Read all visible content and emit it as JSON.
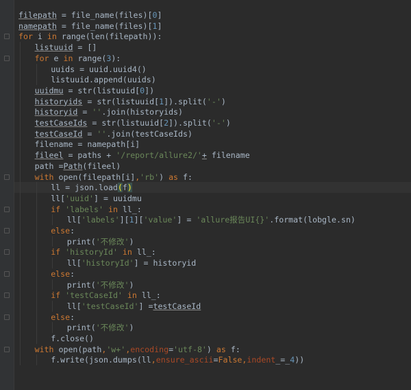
{
  "lines": [
    {
      "indent": 0,
      "tokens": [
        {
          "t": "filepath",
          "c": "u"
        },
        {
          "t": " = file_name(files)["
        },
        {
          "t": "0",
          "c": "num"
        },
        {
          "t": "]"
        }
      ]
    },
    {
      "indent": 0,
      "tokens": [
        {
          "t": "namepath",
          "c": "u"
        },
        {
          "t": " = file_name(files)["
        },
        {
          "t": "1",
          "c": "num"
        },
        {
          "t": "]"
        }
      ]
    },
    {
      "indent": 0,
      "tokens": [
        {
          "t": "for",
          "c": "kw"
        },
        {
          "t": " i "
        },
        {
          "t": "in",
          "c": "kw"
        },
        {
          "t": " range(len(filepath)):"
        }
      ]
    },
    {
      "indent": 1,
      "tokens": [
        {
          "t": "listuuid",
          "c": "u"
        },
        {
          "t": " = []"
        }
      ]
    },
    {
      "indent": 1,
      "tokens": [
        {
          "t": "for",
          "c": "kw"
        },
        {
          "t": " e "
        },
        {
          "t": "in",
          "c": "kw"
        },
        {
          "t": " range("
        },
        {
          "t": "3",
          "c": "num"
        },
        {
          "t": "):"
        }
      ]
    },
    {
      "indent": 2,
      "tokens": [
        {
          "t": "uuids = uuid.uuid4()"
        }
      ]
    },
    {
      "indent": 2,
      "tokens": [
        {
          "t": "listuuid.append(uuids)"
        }
      ]
    },
    {
      "indent": 1,
      "tokens": [
        {
          "t": "uuidmu",
          "c": "u"
        },
        {
          "t": " = str(listuuid["
        },
        {
          "t": "0",
          "c": "num"
        },
        {
          "t": "])"
        }
      ]
    },
    {
      "indent": 1,
      "tokens": [
        {
          "t": "historyids",
          "c": "u"
        },
        {
          "t": " = str(listuuid["
        },
        {
          "t": "1",
          "c": "num"
        },
        {
          "t": "]).split("
        },
        {
          "t": "'-'",
          "c": "str"
        },
        {
          "t": ")"
        }
      ]
    },
    {
      "indent": 1,
      "tokens": [
        {
          "t": "historyid",
          "c": "u"
        },
        {
          "t": " = "
        },
        {
          "t": "''",
          "c": "str"
        },
        {
          "t": ".join(historyids)"
        }
      ]
    },
    {
      "indent": 1,
      "tokens": [
        {
          "t": "testCaseIds",
          "c": "u"
        },
        {
          "t": " = str(listuuid["
        },
        {
          "t": "2",
          "c": "num"
        },
        {
          "t": "]).split("
        },
        {
          "t": "'-'",
          "c": "str"
        },
        {
          "t": ")"
        }
      ]
    },
    {
      "indent": 1,
      "tokens": [
        {
          "t": "testCaseId",
          "c": "u"
        },
        {
          "t": " = "
        },
        {
          "t": "''",
          "c": "str"
        },
        {
          "t": ".join(testCaseIds)"
        }
      ]
    },
    {
      "indent": 1,
      "tokens": [
        {
          "t": "filename = namepath[i]"
        }
      ]
    },
    {
      "indent": 1,
      "tokens": [
        {
          "t": "fileel",
          "c": "u"
        },
        {
          "t": " = paths + "
        },
        {
          "t": "'/report/allure2/'",
          "c": "str"
        },
        {
          "t": "+",
          "c": "u"
        },
        {
          "t": " filename"
        }
      ]
    },
    {
      "indent": 1,
      "tokens": [
        {
          "t": "path ="
        },
        {
          "t": "Path",
          "c": "u"
        },
        {
          "t": "(fileel)"
        }
      ]
    },
    {
      "indent": 1,
      "tokens": [
        {
          "t": "with",
          "c": "kw"
        },
        {
          "t": " open(filepath[i]"
        },
        {
          "t": ",",
          "c": "kw"
        },
        {
          "t": "'rb'",
          "c": "str"
        },
        {
          "t": ") "
        },
        {
          "t": "as",
          "c": "kw"
        },
        {
          "t": " f:"
        }
      ]
    },
    {
      "indent": 2,
      "tokens": [
        {
          "t": "ll = json.load"
        },
        {
          "t": "(",
          "c": "paren"
        },
        {
          "t": "f"
        },
        {
          "t": ")",
          "c": "paren"
        }
      ]
    },
    {
      "indent": 2,
      "tokens": [
        {
          "t": "ll["
        },
        {
          "t": "'uuid'",
          "c": "str"
        },
        {
          "t": "] = uuidmu"
        }
      ]
    },
    {
      "indent": 2,
      "tokens": [
        {
          "t": "if",
          "c": "kw"
        },
        {
          "t": " "
        },
        {
          "t": "'labels'",
          "c": "str"
        },
        {
          "t": " "
        },
        {
          "t": "in",
          "c": "kw"
        },
        {
          "t": " ll_:"
        }
      ]
    },
    {
      "indent": 3,
      "tokens": [
        {
          "t": "ll["
        },
        {
          "t": "'labels'",
          "c": "str"
        },
        {
          "t": "]["
        },
        {
          "t": "1",
          "c": "num"
        },
        {
          "t": "]["
        },
        {
          "t": "'value'",
          "c": "str"
        },
        {
          "t": "] = "
        },
        {
          "t": "'allure报告UI{}'",
          "c": "str"
        },
        {
          "t": ".format(lobgle.sn)"
        }
      ]
    },
    {
      "indent": 2,
      "tokens": [
        {
          "t": "else",
          "c": "kw"
        },
        {
          "t": ":"
        }
      ]
    },
    {
      "indent": 3,
      "tokens": [
        {
          "t": "print("
        },
        {
          "t": "'不修改'",
          "c": "str"
        },
        {
          "t": ")"
        }
      ]
    },
    {
      "indent": 2,
      "tokens": [
        {
          "t": "if",
          "c": "kw"
        },
        {
          "t": " "
        },
        {
          "t": "'historyId'",
          "c": "str"
        },
        {
          "t": " "
        },
        {
          "t": "in",
          "c": "kw"
        },
        {
          "t": " ll_:"
        }
      ]
    },
    {
      "indent": 3,
      "tokens": [
        {
          "t": "ll["
        },
        {
          "t": "'historyId'",
          "c": "str"
        },
        {
          "t": "] = historyid"
        }
      ]
    },
    {
      "indent": 2,
      "tokens": [
        {
          "t": "else",
          "c": "kw"
        },
        {
          "t": ":"
        }
      ]
    },
    {
      "indent": 3,
      "tokens": [
        {
          "t": "print("
        },
        {
          "t": "'不修改'",
          "c": "str"
        },
        {
          "t": ")"
        }
      ]
    },
    {
      "indent": 2,
      "tokens": [
        {
          "t": "if",
          "c": "kw"
        },
        {
          "t": " "
        },
        {
          "t": "'testCaseId'",
          "c": "str"
        },
        {
          "t": " "
        },
        {
          "t": "in",
          "c": "kw"
        },
        {
          "t": " ll_:"
        }
      ]
    },
    {
      "indent": 3,
      "tokens": [
        {
          "t": "ll["
        },
        {
          "t": "'testCaseId'",
          "c": "str"
        },
        {
          "t": "] ="
        },
        {
          "t": "testCaseId",
          "c": "u"
        }
      ]
    },
    {
      "indent": 2,
      "tokens": [
        {
          "t": "else",
          "c": "kw"
        },
        {
          "t": ":"
        }
      ]
    },
    {
      "indent": 3,
      "tokens": [
        {
          "t": "print("
        },
        {
          "t": "'不修改'",
          "c": "str"
        },
        {
          "t": ")"
        }
      ]
    },
    {
      "indent": 2,
      "tokens": [
        {
          "t": "f.close()"
        }
      ]
    },
    {
      "indent": 1,
      "tokens": [
        {
          "t": "with",
          "c": "kw"
        },
        {
          "t": " open(path"
        },
        {
          "t": ",",
          "c": "kw"
        },
        {
          "t": "'w+'",
          "c": "str"
        },
        {
          "t": ",",
          "c": "kw"
        },
        {
          "t": "encoding",
          "c": "kwarg"
        },
        {
          "t": "="
        },
        {
          "t": "'utf-8'",
          "c": "str"
        },
        {
          "t": ") "
        },
        {
          "t": "as",
          "c": "kw"
        },
        {
          "t": " f:"
        }
      ]
    },
    {
      "indent": 2,
      "tokens": [
        {
          "t": "f.write(json.dumps(ll"
        },
        {
          "t": ",",
          "c": "kw"
        },
        {
          "t": "ensure_ascii",
          "c": "kwarg"
        },
        {
          "t": "="
        },
        {
          "t": "False",
          "c": "kw"
        },
        {
          "t": ",",
          "c": "kw"
        },
        {
          "t": "indent",
          "c": "kwarg"
        },
        {
          "t": "_=_"
        },
        {
          "t": "4",
          "c": "num"
        },
        {
          "t": "))"
        }
      ]
    }
  ],
  "highlighted_line": 16,
  "colors": {
    "background": "#2b2b2b",
    "keyword": "#cc7832",
    "string": "#6a8759",
    "number": "#6897bb",
    "kwarg": "#aa4926",
    "text": "#a9b7c6"
  }
}
